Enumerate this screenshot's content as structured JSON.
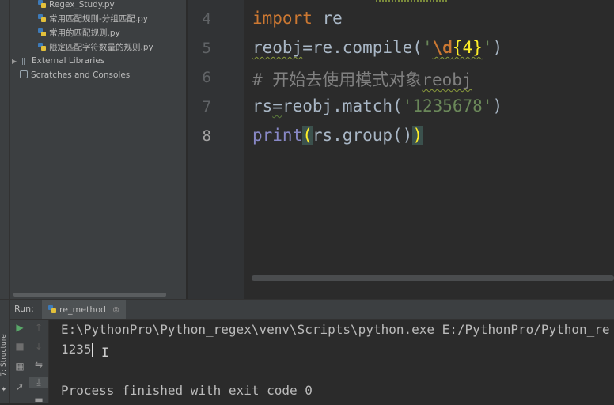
{
  "project_tree": {
    "items": [
      {
        "label": "Regex_Study.py",
        "type": "file"
      },
      {
        "label": "常用匹配规则-分组匹配.py",
        "type": "file"
      },
      {
        "label": "常用的匹配规则.py",
        "type": "file"
      },
      {
        "label": "限定匹配字符数量的规则.py",
        "type": "file"
      },
      {
        "label": "External Libraries",
        "type": "libraries"
      },
      {
        "label": "Scratches and Consoles",
        "type": "scratches"
      }
    ]
  },
  "side_tab": {
    "structure": "7: Structure"
  },
  "editor": {
    "line_numbers": [
      "4",
      "5",
      "6",
      "7",
      "8"
    ],
    "current_line": "8",
    "lines": {
      "l4": {
        "kw": "import",
        "rest": " re"
      },
      "l5": {
        "a": "reobj",
        "b": "=re.compile(",
        "q1": "'",
        "esc": "\\d",
        "rep": "{4}",
        "q2": "'",
        "end": ")"
      },
      "l6": {
        "hash": "# ",
        "text": "开始去使用模式对象",
        "obj": "reobj"
      },
      "l7": {
        "a": "rs",
        "b": "=",
        "c": "reobj.match(",
        "str": "'1235678'",
        "end": ")"
      },
      "l8": {
        "fn": "print",
        "open": "(",
        "mid": "rs.group()",
        "close": ")"
      }
    }
  },
  "run": {
    "label": "Run:",
    "tab_name": "re_method",
    "console_lines": [
      "E:\\PythonPro\\Python_regex\\venv\\Scripts\\python.exe E:/PythonPro/Python_re",
      "1235",
      "Process finished with exit code 0"
    ]
  },
  "colors": {
    "keyword": "#cc7832",
    "string": "#6a8759",
    "comment": "#808080",
    "builtin": "#8888c6",
    "bracket_highlight": "#ffef28"
  }
}
